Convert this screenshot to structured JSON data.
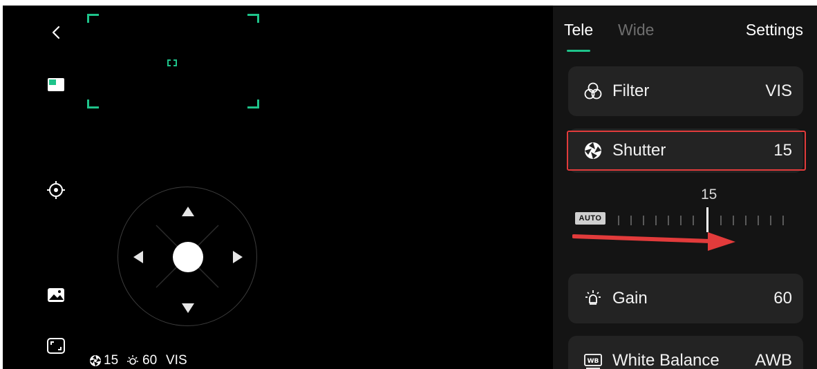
{
  "camera": {
    "status": {
      "shutter_value": "15",
      "gain_value": "60",
      "filter_value": "VIS"
    }
  },
  "panel": {
    "tabs": [
      "Tele",
      "Wide"
    ],
    "active_tab": "Tele",
    "settings_label": "Settings",
    "rows": {
      "filter": {
        "label": "Filter",
        "value": "VIS",
        "icon": "filter-icon"
      },
      "shutter": {
        "label": "Shutter",
        "value": "15",
        "icon": "aperture-icon"
      },
      "gain": {
        "label": "Gain",
        "value": "60",
        "icon": "brightness-icon"
      },
      "white_balance": {
        "label": "White Balance",
        "value": "AWB",
        "icon": "wb-icon"
      }
    },
    "shutter_slider": {
      "auto_label": "AUTO",
      "current_value": "15"
    }
  },
  "colors": {
    "accent": "#1ec38a",
    "highlight": "#e23b3b",
    "panel_bg": "#141414",
    "card_bg": "#232323"
  },
  "icons": [
    "back-icon",
    "pip-icon",
    "target-icon",
    "gallery-icon",
    "fullscreen-icon"
  ]
}
